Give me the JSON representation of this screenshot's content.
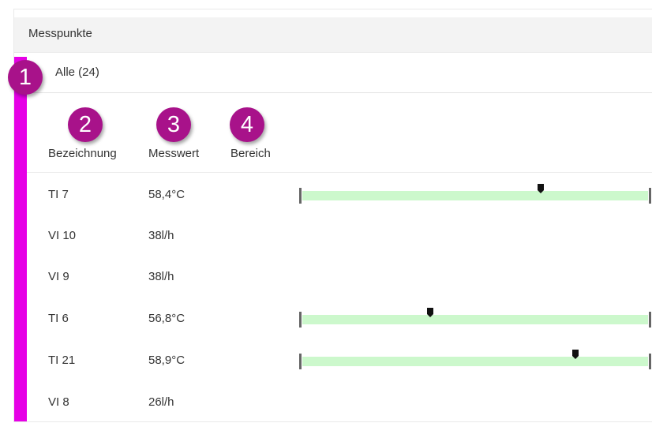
{
  "panel": {
    "title": "Messpunkte"
  },
  "group": {
    "label": "Alle (24)"
  },
  "badges": [
    "1",
    "2",
    "3",
    "4"
  ],
  "columns": {
    "name": "Bezeichnung",
    "value": "Messwert",
    "range": "Bereich"
  },
  "colors": {
    "accent": "#e600e6",
    "badge": "#a8128a",
    "range_fill": "#ccf8cc"
  },
  "rows": [
    {
      "name": "TI 7",
      "value": "58,4°C",
      "range_position": 0.69
    },
    {
      "name": "VI 10",
      "value": "38l/h",
      "range_position": null
    },
    {
      "name": "VI 9",
      "value": "38l/h",
      "range_position": null
    },
    {
      "name": "TI 6",
      "value": "56,8°C",
      "range_position": 0.37
    },
    {
      "name": "TI 21",
      "value": "58,9°C",
      "range_position": 0.79
    },
    {
      "name": "VI 8",
      "value": "26l/h",
      "range_position": null
    }
  ]
}
